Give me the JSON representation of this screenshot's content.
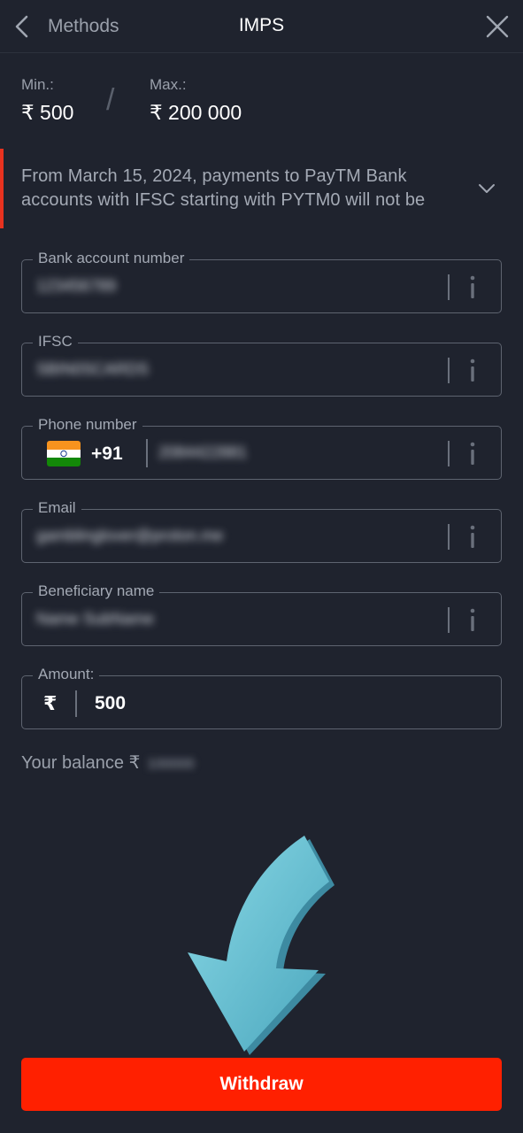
{
  "header": {
    "back_label": "Methods",
    "title": "IMPS"
  },
  "limits": {
    "min_label": "Min.:",
    "min_value": "₹ 500",
    "separator": "/",
    "max_label": "Max.:",
    "max_value": "₹ 200 000"
  },
  "notice": {
    "text": "From March 15, 2024, payments to PayTM Bank accounts with IFSC starting with PYTM0 will not be"
  },
  "form": {
    "bank_account": {
      "label": "Bank account number",
      "value": "123456789"
    },
    "ifsc": {
      "label": "IFSC",
      "value": "SBIN0SCARDS"
    },
    "phone": {
      "label": "Phone number",
      "country_code": "+91",
      "value": "2084422881"
    },
    "email": {
      "label": "Email",
      "value": "gamblinglover@proton.me"
    },
    "beneficiary": {
      "label": "Beneficiary name",
      "value": "Name SubName"
    },
    "amount": {
      "label": "Amount:",
      "currency_symbol": "₹",
      "value": "500"
    }
  },
  "balance": {
    "label": "Your balance ₹",
    "value": "100000"
  },
  "actions": {
    "withdraw_label": "Withdraw"
  },
  "colors": {
    "background": "#1f232e",
    "accent": "#ff2000",
    "notice_bar": "#e8321f",
    "pointer_arrow": "#6cc3d5"
  },
  "icons": {
    "back": "chevron-left-icon",
    "close": "close-icon",
    "expand": "chevron-down-icon",
    "info": "info-icon",
    "flag": "india-flag-icon"
  }
}
